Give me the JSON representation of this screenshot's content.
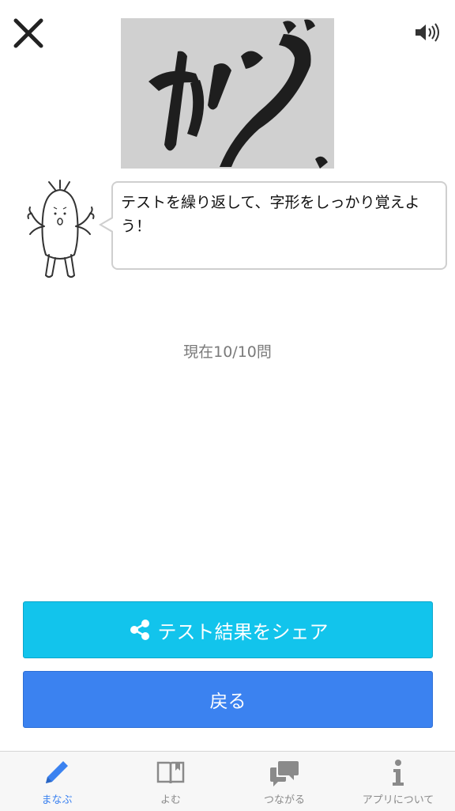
{
  "message": "テストを繰り返して、字形をしっかり覚えよう！",
  "progress_text": "現在10/10問",
  "share_button_label": "テスト結果をシェア",
  "back_button_label": "戻る",
  "tabs": [
    {
      "label": "まなぶ",
      "icon": "pencil-icon",
      "active": true
    },
    {
      "label": "よむ",
      "icon": "book-icon",
      "active": false
    },
    {
      "label": "つながる",
      "icon": "chat-bubbles-icon",
      "active": false
    },
    {
      "label": "アプリについて",
      "icon": "info-icon",
      "active": false
    }
  ],
  "colors": {
    "share": "#12c4ec",
    "back": "#3b82f0",
    "active_tab": "#3b82f0",
    "inactive_tab": "#8a8a8a"
  }
}
